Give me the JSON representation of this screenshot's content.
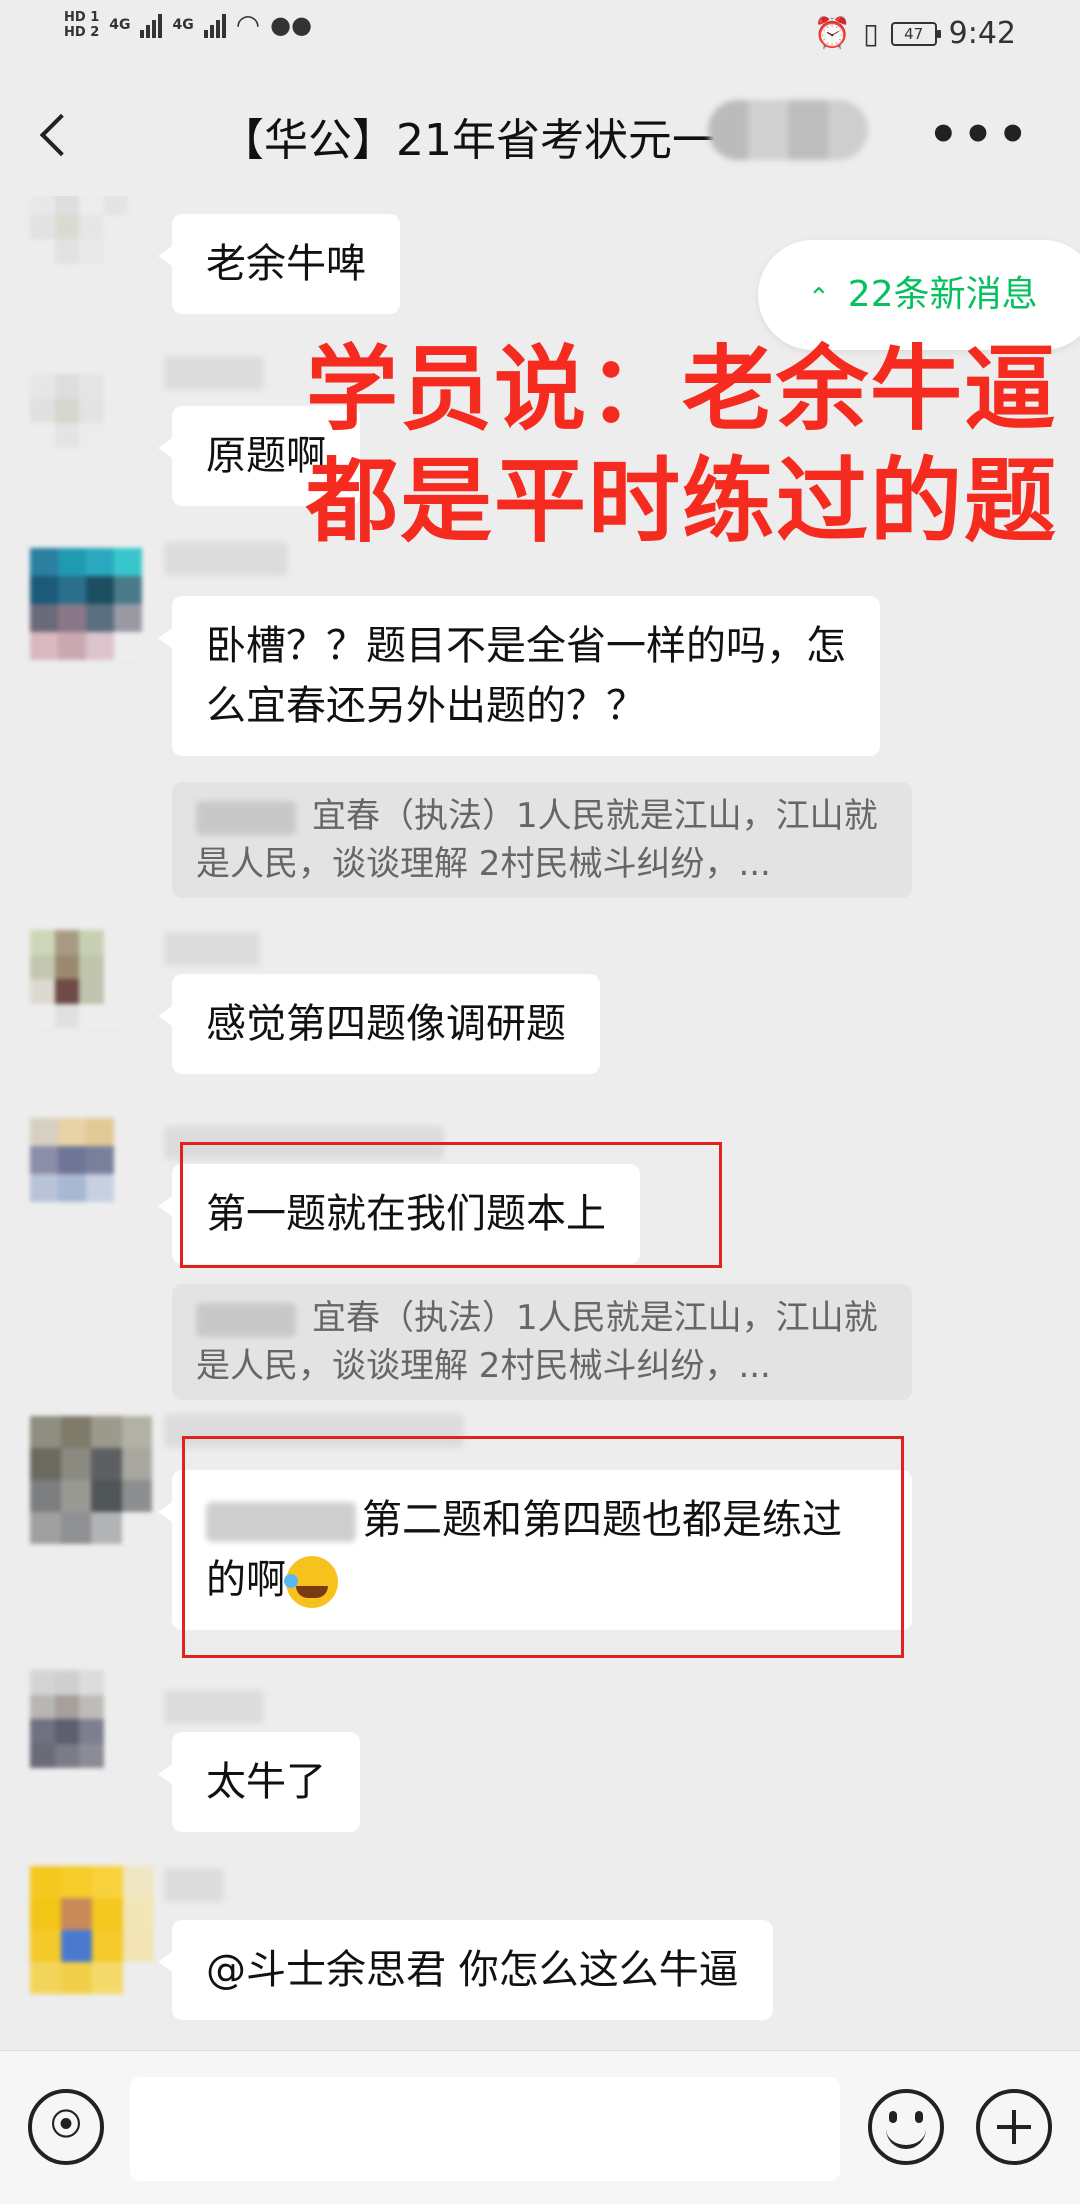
{
  "status_bar": {
    "hd1": "HD 1",
    "hd2": "HD 2",
    "net1": "4G",
    "net2": "4G",
    "battery": "47",
    "time": "9:42"
  },
  "header": {
    "title": "【华公】21年省考状元一"
  },
  "new_messages": {
    "label": "22条新消息"
  },
  "overlay": {
    "line1": "学员说：老余牛逼",
    "line2": "都是平时练过的题"
  },
  "messages": [
    {
      "text": "老余牛啤"
    },
    {
      "text": "原题啊"
    },
    {
      "text": "卧槽？？题目不是全省一样的吗，怎么宜春还另外出题的？？"
    },
    {
      "quote": "宜春（执法）1人民就是江山，江山就是人民，谈谈理解 2村民械斗纠纷，..."
    },
    {
      "text": "感觉第四题像调研题"
    },
    {
      "text": "第一题就在我们题本上"
    },
    {
      "quote": "宜春（执法）1人民就是江山，江山就是人民，谈谈理解 2村民械斗纠纷，..."
    },
    {
      "text": "第二题和第四题也都是练过的啊"
    },
    {
      "text": "太牛了"
    },
    {
      "text": "@斗士余思君  你怎么这么牛逼"
    }
  ],
  "icons": {
    "back": "back-icon",
    "more": "more-icon",
    "voice": "voice-icon",
    "emoji": "emoji-icon",
    "plus": "plus-icon"
  },
  "colors": {
    "accent_green": "#07c160",
    "overlay_red": "#f52b20",
    "highlight_box": "#e0231b",
    "background": "#ededed"
  }
}
